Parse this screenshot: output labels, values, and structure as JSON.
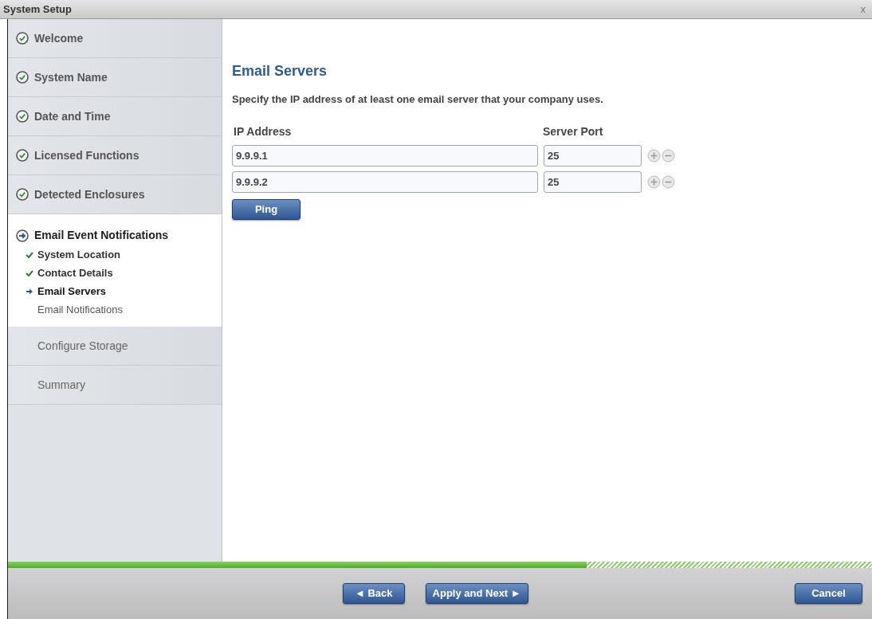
{
  "window": {
    "title": "System Setup",
    "close": "x"
  },
  "steps": [
    {
      "label": "Welcome",
      "kind": "done"
    },
    {
      "label": "System Name",
      "kind": "done"
    },
    {
      "label": "Date and Time",
      "kind": "done"
    },
    {
      "label": "Licensed Functions",
      "kind": "done"
    },
    {
      "label": "Detected Enclosures",
      "kind": "done"
    },
    {
      "label": "Email Event Notifications",
      "kind": "current",
      "children": [
        {
          "label": "System Location",
          "kind": "done"
        },
        {
          "label": "Contact Details",
          "kind": "done"
        },
        {
          "label": "Email Servers",
          "kind": "current"
        },
        {
          "label": "Email Notifications",
          "kind": "pending"
        }
      ]
    },
    {
      "label": "Configure Storage",
      "kind": "pending"
    },
    {
      "label": "Summary",
      "kind": "pending"
    }
  ],
  "content": {
    "heading": "Email Servers",
    "description": "Specify the IP address of at least one email server that your company uses.",
    "columns": [
      "IP Address",
      "Server Port"
    ],
    "servers": [
      {
        "ip": "9.9.9.1",
        "port": "25"
      },
      {
        "ip": "9.9.9.2",
        "port": "25"
      }
    ],
    "ping_button": "Ping"
  },
  "progress": {
    "level": 0.67
  },
  "footer": {
    "back": "◄ Back",
    "next": "Apply and Next ►",
    "cancel": "Cancel"
  }
}
